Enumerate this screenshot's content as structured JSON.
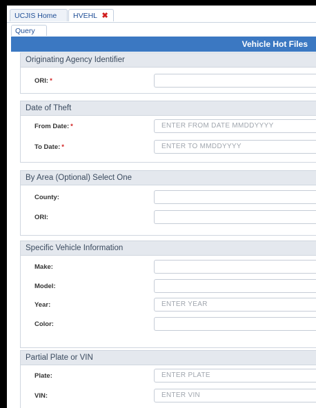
{
  "tabs": {
    "home_label": "UCJIS Home",
    "hvehl_label": "HVEHL",
    "close_glyph": "✖"
  },
  "query_tab_label": "Query",
  "page_title": "Vehicle Hot Files",
  "sections": {
    "ori": {
      "title": "Originating Agency Identifier",
      "ori_label": "ORI:",
      "ori_required": "*",
      "ori_value": "",
      "ori_placeholder": ""
    },
    "date": {
      "title": "Date of Theft",
      "from_label": "From Date:",
      "from_required": "*",
      "from_placeholder": "ENTER FROM DATE MMDDYYYY",
      "to_label": "To Date:",
      "to_required": "*",
      "to_placeholder": "ENTER TO MMDDYYYY"
    },
    "area": {
      "title": "By Area (Optional) Select One",
      "county_label": "County:",
      "county_value": "",
      "ori_label": "ORI:",
      "ori_value": ""
    },
    "vehicle": {
      "title": "Specific Vehicle Information",
      "make_label": "Make:",
      "make_value": "",
      "model_label": "Model:",
      "model_value": "",
      "year_label": "Year:",
      "year_placeholder": "ENTER YEAR",
      "color_label": "Color:",
      "color_value": ""
    },
    "plate": {
      "title": "Partial Plate or VIN",
      "plate_label": "Plate:",
      "plate_placeholder": "ENTER PLATE",
      "vin_label": "VIN:",
      "vin_placeholder": "ENTER VIN"
    }
  },
  "colors": {
    "title_bar": "#3b78c2",
    "section_header": "#e4e8ee",
    "required": "#d11f1f"
  }
}
